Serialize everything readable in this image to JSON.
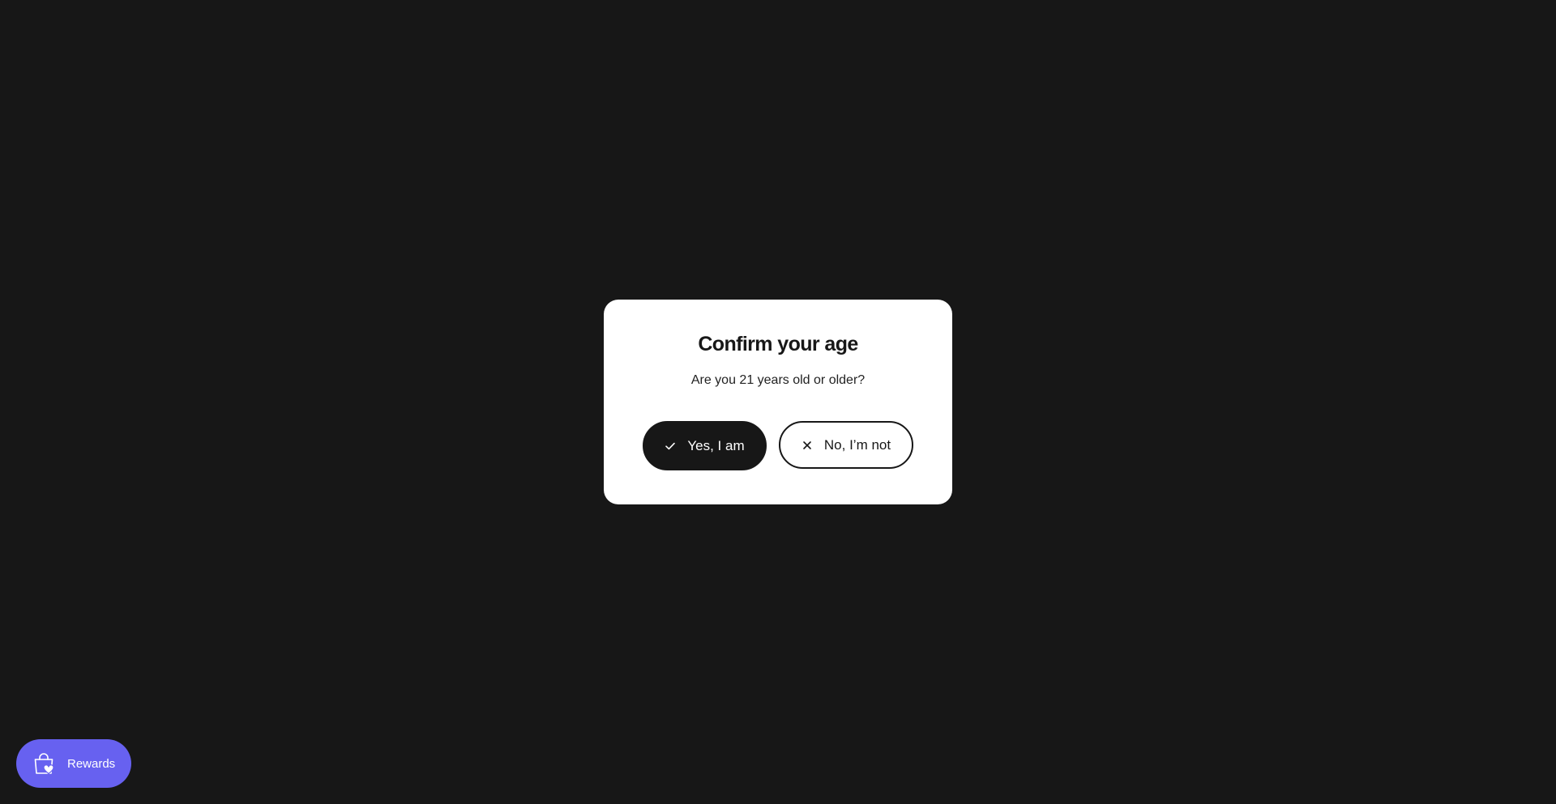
{
  "colors": {
    "background": "#171717",
    "modal": "#ffffff",
    "primary_button": "#171717",
    "rewards_button": "#6761f0"
  },
  "age_gate": {
    "title": "Confirm your age",
    "question": "Are you 21 years old or older?",
    "yes_button": {
      "label": "Yes, I am",
      "icon": "check-icon"
    },
    "no_button": {
      "label": "No, I’m not",
      "icon": "close-icon"
    }
  },
  "rewards_launcher": {
    "label": "Rewards",
    "icon": "shopping-bag-heart-icon"
  }
}
